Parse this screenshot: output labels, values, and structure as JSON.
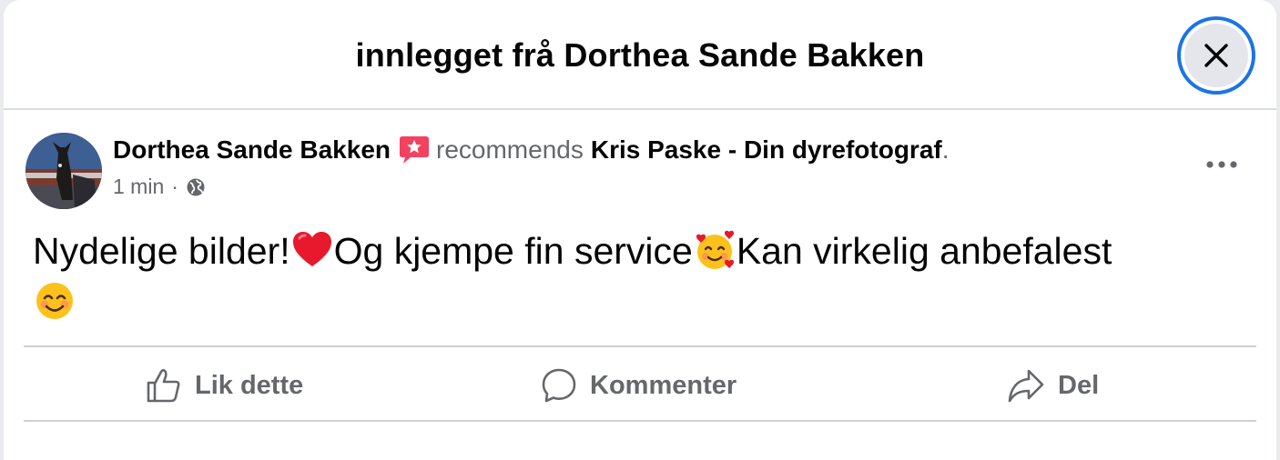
{
  "modal": {
    "title": "innlegget frå Dorthea Sande Bakken",
    "close_icon": "close-icon"
  },
  "post": {
    "author": "Dorthea Sande Bakken",
    "recommend_icon": "recommendation-star-icon",
    "verb": "recommends",
    "page": "Kris Paske - Din dyrefotograf",
    "period": ".",
    "time": "1 min",
    "separator": "·",
    "audience_icon": "globe-icon",
    "more_icon": "more-options-icon",
    "text_parts": [
      "Nydelige bilder!",
      "Og kjempe fin service",
      "Kan virkelig anbefalest"
    ],
    "emojis": [
      "red-heart-emoji",
      "smiling-face-with-hearts-emoji",
      "smiling-face-emoji"
    ]
  },
  "actions": [
    {
      "label": "Lik dette",
      "icon": "like-thumb-icon"
    },
    {
      "label": "Kommenter",
      "icon": "comment-bubble-icon"
    },
    {
      "label": "Del",
      "icon": "share-arrow-icon"
    }
  ],
  "colors": {
    "text": "#050505",
    "secondary": "#65676b",
    "focus_ring": "#1b74e4",
    "recommend_pink": "#f3425f",
    "divider": "#ced0d4"
  }
}
